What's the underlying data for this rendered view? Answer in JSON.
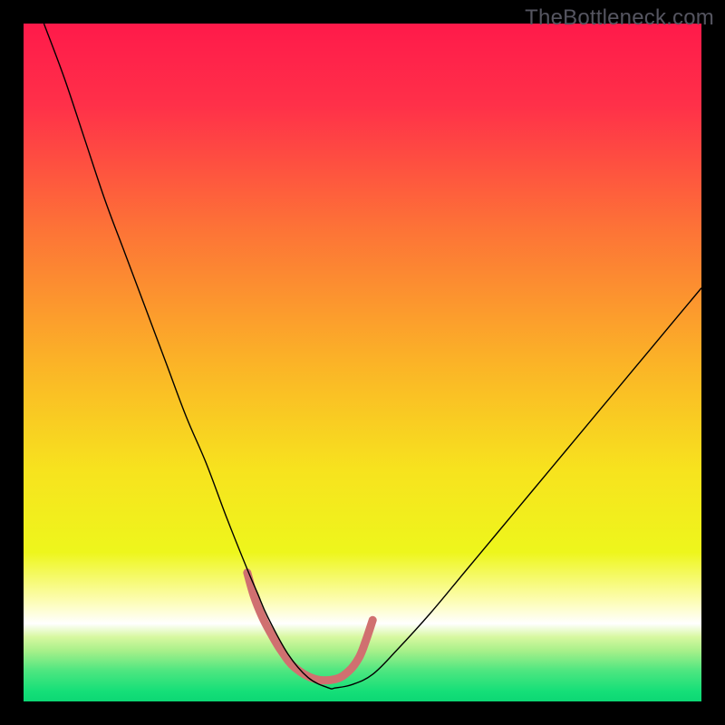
{
  "watermark": "TheBottleneck.com",
  "chart_data": {
    "type": "line",
    "title": "",
    "xlabel": "",
    "ylabel": "",
    "xlim": [
      0,
      100
    ],
    "ylim": [
      0,
      100
    ],
    "grid": false,
    "legend": false,
    "background_gradient_stops": [
      {
        "offset": 0.0,
        "color": "#ff1a4a"
      },
      {
        "offset": 0.12,
        "color": "#ff3049"
      },
      {
        "offset": 0.3,
        "color": "#fd7237"
      },
      {
        "offset": 0.5,
        "color": "#fbb327"
      },
      {
        "offset": 0.66,
        "color": "#f7e31e"
      },
      {
        "offset": 0.78,
        "color": "#eef61c"
      },
      {
        "offset": 0.85,
        "color": "#fcfdb0"
      },
      {
        "offset": 0.885,
        "color": "#ffffff"
      },
      {
        "offset": 0.905,
        "color": "#d7f8a0"
      },
      {
        "offset": 0.925,
        "color": "#a8f08a"
      },
      {
        "offset": 0.955,
        "color": "#4de680"
      },
      {
        "offset": 0.985,
        "color": "#15df78"
      },
      {
        "offset": 1.0,
        "color": "#0cd774"
      }
    ],
    "series": [
      {
        "name": "bottleneck-curve",
        "stroke": "#000000",
        "stroke_width": 1.4,
        "x": [
          3,
          6,
          9,
          12,
          15,
          18,
          21,
          24,
          27,
          30,
          33,
          34.5,
          36,
          39,
          42,
          45,
          46,
          48.5,
          51.5,
          55,
          60,
          65,
          70,
          75,
          80,
          85,
          90,
          95,
          100
        ],
        "y": [
          100,
          92,
          83,
          74,
          66,
          58,
          50,
          42,
          35,
          27,
          19.5,
          16,
          12.5,
          7,
          3.5,
          2,
          2,
          2.5,
          4,
          7.5,
          13,
          19,
          25,
          31,
          37,
          43,
          49,
          55,
          61
        ]
      },
      {
        "name": "highlight-band",
        "stroke": "#d07070",
        "stroke_width": 9,
        "linecap": "round",
        "x": [
          33.0,
          34.0,
          35.2,
          36.5,
          38.0,
          40.0,
          43.0,
          46.0,
          48.0,
          49.5,
          50.5,
          51.5
        ],
        "y": [
          19.0,
          15.5,
          12.5,
          10.0,
          7.5,
          5.0,
          3.3,
          3.3,
          4.5,
          6.5,
          9.0,
          12.0
        ]
      }
    ],
    "annotations": []
  }
}
